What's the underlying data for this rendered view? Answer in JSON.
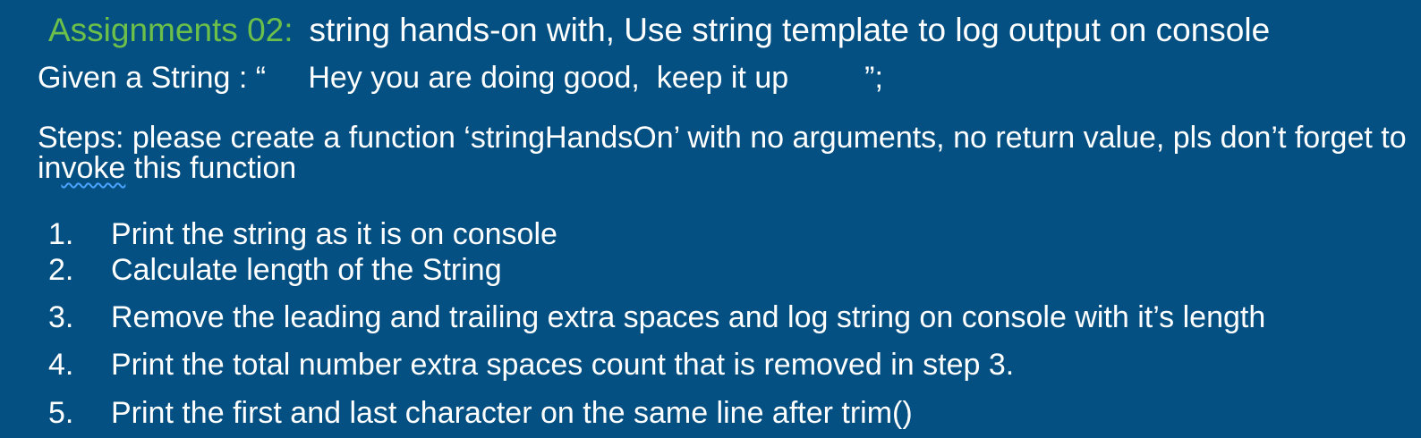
{
  "title": {
    "prefix": "Assignments 02:",
    "text": "string hands-on with, Use string template to log output on console"
  },
  "given": "Given a String : “     Hey you are doing good,  keep it up         ”;",
  "steps": {
    "line1": "Steps: please create a function ‘stringHandsOn’ with no arguments, no return value, pls don’t forget to",
    "line2_start": "in",
    "line2_underlined": "voke",
    "line2_end": " this function"
  },
  "list": [
    {
      "num": "1.",
      "text": "Print the string as it is on console"
    },
    {
      "num": "2.",
      "text": "Calculate length of the String"
    },
    {
      "num": "3.",
      "text": "Remove the leading and trailing extra spaces and log string on console with it’s length"
    },
    {
      "num": "4.",
      "text": "Print the total number extra spaces count that is removed in step 3."
    },
    {
      "num": "5.",
      "text": "Print the first and last character on the same line after trim()"
    }
  ],
  "colors": {
    "background": "#055082",
    "accent": "#6cc04a",
    "text": "#ffffff",
    "spellcheck": "#4aa3ff"
  }
}
